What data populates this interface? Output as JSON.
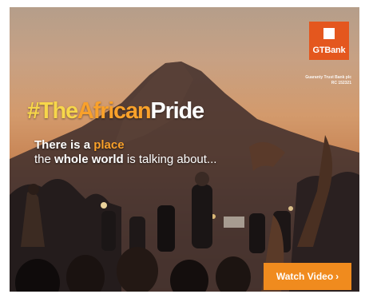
{
  "brand": {
    "logo_text": "GTBank",
    "legal_name": "Guaranty Trust Bank plc",
    "rc_number": "RC 152321",
    "color": "#e4571e"
  },
  "headline": {
    "hash": "#",
    "part1": "The",
    "part2": "African",
    "part3": "Pride"
  },
  "tagline": {
    "line1_prefix": "There is a ",
    "line1_highlight": "place",
    "line2_prefix": "the ",
    "line2_bold": "whole world",
    "line2_suffix": " is talking about..."
  },
  "cta": {
    "label": "Watch Video",
    "icon": "chevron-right-icon",
    "glyph": "›",
    "color": "#f08b1e"
  },
  "colors": {
    "yellow": "#f7d64a",
    "orange": "#f9a12a"
  }
}
